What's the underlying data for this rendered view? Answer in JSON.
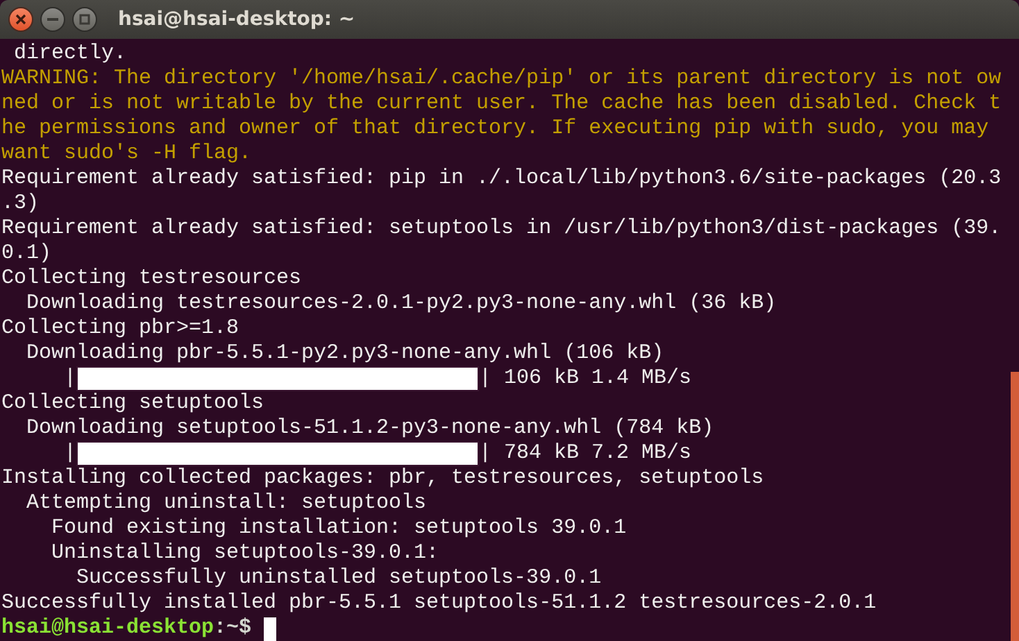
{
  "window": {
    "title": "hsai@hsai-desktop: ~"
  },
  "lines": [
    {
      "kind": "text",
      "text": " directly."
    },
    {
      "kind": "warning",
      "text": "WARNING: The directory '/home/hsai/.cache/pip' or its parent directory is not ow"
    },
    {
      "kind": "warning",
      "text": "ned or is not writable by the current user. The cache has been disabled. Check t"
    },
    {
      "kind": "warning",
      "text": "he permissions and owner of that directory. If executing pip with sudo, you may"
    },
    {
      "kind": "warning",
      "text": "want sudo's -H flag."
    },
    {
      "kind": "text",
      "text": "Requirement already satisfied: pip in ./.local/lib/python3.6/site-packages (20.3"
    },
    {
      "kind": "text",
      "text": ".3)"
    },
    {
      "kind": "text",
      "text": "Requirement already satisfied: setuptools in /usr/lib/python3/dist-packages (39."
    },
    {
      "kind": "text",
      "text": "0.1)"
    },
    {
      "kind": "text",
      "text": "Collecting testresources"
    },
    {
      "kind": "text",
      "text": "  Downloading testresources-2.0.1-py2.py3-none-any.whl (36 kB)"
    },
    {
      "kind": "text",
      "text": "Collecting pbr>=1.8"
    },
    {
      "kind": "text",
      "text": "  Downloading pbr-5.5.1-py2.py3-none-any.whl (106 kB)"
    },
    {
      "kind": "progress",
      "prefix": "     |",
      "level": 1,
      "suffix": "| 106 kB 1.4 MB/s"
    },
    {
      "kind": "text",
      "text": "Collecting setuptools"
    },
    {
      "kind": "text",
      "text": "  Downloading setuptools-51.1.2-py3-none-any.whl (784 kB)"
    },
    {
      "kind": "progress",
      "prefix": "     |",
      "level": 1,
      "suffix": "| 784 kB 7.2 MB/s"
    },
    {
      "kind": "text",
      "text": "Installing collected packages: pbr, testresources, setuptools"
    },
    {
      "kind": "text",
      "text": "  Attempting uninstall: setuptools"
    },
    {
      "kind": "text",
      "text": "    Found existing installation: setuptools 39.0.1"
    },
    {
      "kind": "text",
      "text": "    Uninstalling setuptools-39.0.1:"
    },
    {
      "kind": "text",
      "text": "      Successfully uninstalled setuptools-39.0.1"
    },
    {
      "kind": "text",
      "text": "Successfully installed pbr-5.5.1 setuptools-51.1.2 testresources-2.0.1"
    },
    {
      "kind": "prompt",
      "user": "hsai@hsai-desktop",
      "path": ":~$"
    }
  ]
}
